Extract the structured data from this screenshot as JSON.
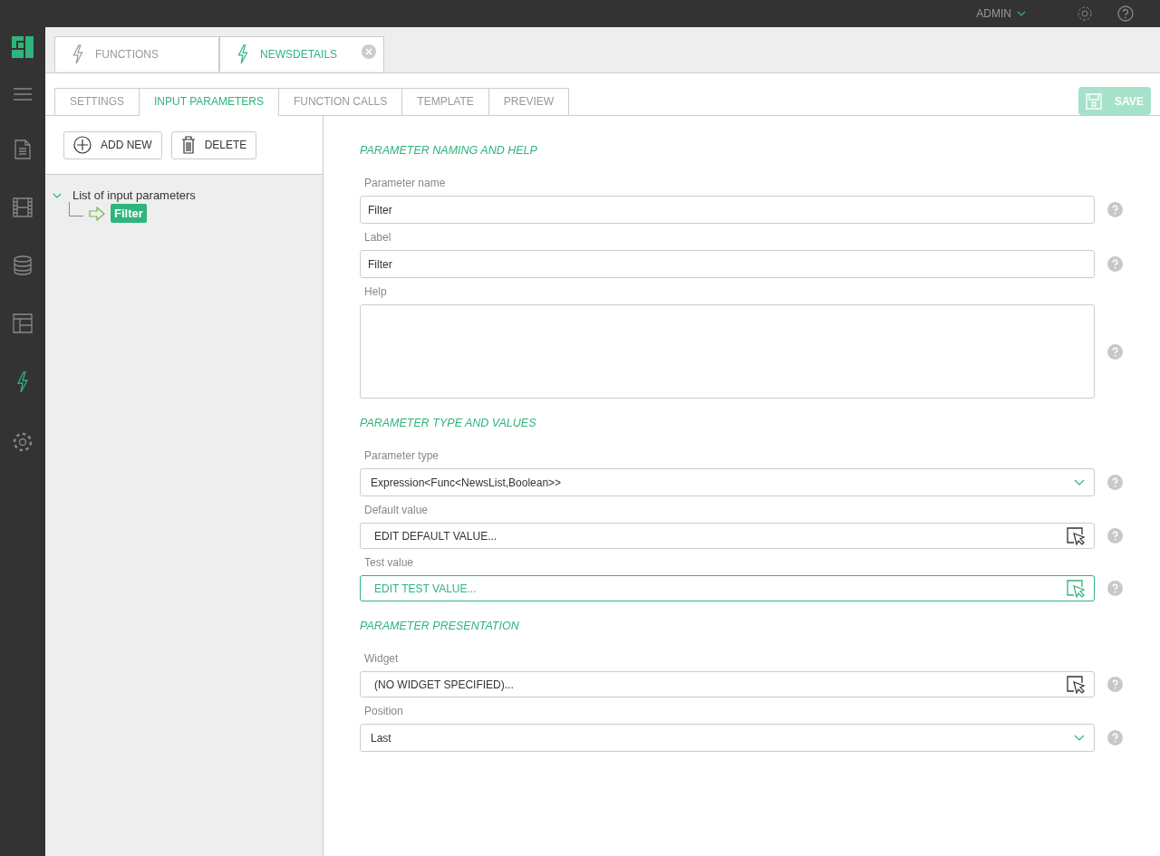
{
  "top_bar": {
    "user": "ADMIN"
  },
  "sidebar": {
    "items": [
      {
        "selected": false
      },
      {
        "selected": false
      },
      {
        "selected": false
      },
      {
        "selected": false
      },
      {
        "selected": true
      },
      {
        "selected": false
      }
    ]
  },
  "doc_tabs": [
    {
      "label": "FUNCTIONS",
      "selected": false,
      "closable": false
    },
    {
      "label": "NEWSDETAILS",
      "selected": true,
      "closable": true
    }
  ],
  "save_button": {
    "label": "SAVE",
    "disabled": true
  },
  "tabs": [
    {
      "label": "SETTINGS",
      "selected": false
    },
    {
      "label": "INPUT PARAMETERS",
      "selected": true
    },
    {
      "label": "FUNCTION CALLS",
      "selected": false
    },
    {
      "label": "TEMPLATE",
      "selected": false
    },
    {
      "label": "PREVIEW",
      "selected": false
    }
  ],
  "toolbar": [
    {
      "kind": "add",
      "label": "ADD NEW"
    },
    {
      "kind": "delete",
      "label": "DELETE"
    }
  ],
  "tree": {
    "label": "List of input parameters",
    "expanded": true,
    "children": [
      {
        "label": "Filter",
        "selected": true
      }
    ]
  },
  "sections": [
    {
      "title": "PARAMETER NAMING AND HELP",
      "fields": [
        {
          "kind": "text",
          "label": "Parameter name",
          "value": "Filter",
          "focused": false
        },
        {
          "kind": "text",
          "label": "Label",
          "value": "Filter",
          "focused": false
        },
        {
          "kind": "textarea",
          "label": "Help",
          "focused": false
        }
      ]
    },
    {
      "title": "PARAMETER TYPE AND VALUES",
      "fields": [
        {
          "kind": "select",
          "label": "Parameter type",
          "value": "Expression<Func<NewsList,Boolean>>",
          "focused": false
        },
        {
          "kind": "picker",
          "label": "Default value",
          "value": "EDIT DEFAULT VALUE...",
          "focused": false
        },
        {
          "kind": "picker",
          "label": "Test value",
          "value": "EDIT TEST VALUE...",
          "focused": true
        }
      ]
    },
    {
      "title": "PARAMETER PRESENTATION",
      "fields": [
        {
          "kind": "picker",
          "label": "Widget",
          "value": "(NO WIDGET SPECIFIED)...",
          "focused": false
        },
        {
          "kind": "select",
          "label": "Position",
          "value": "Last",
          "focused": false
        }
      ]
    }
  ]
}
